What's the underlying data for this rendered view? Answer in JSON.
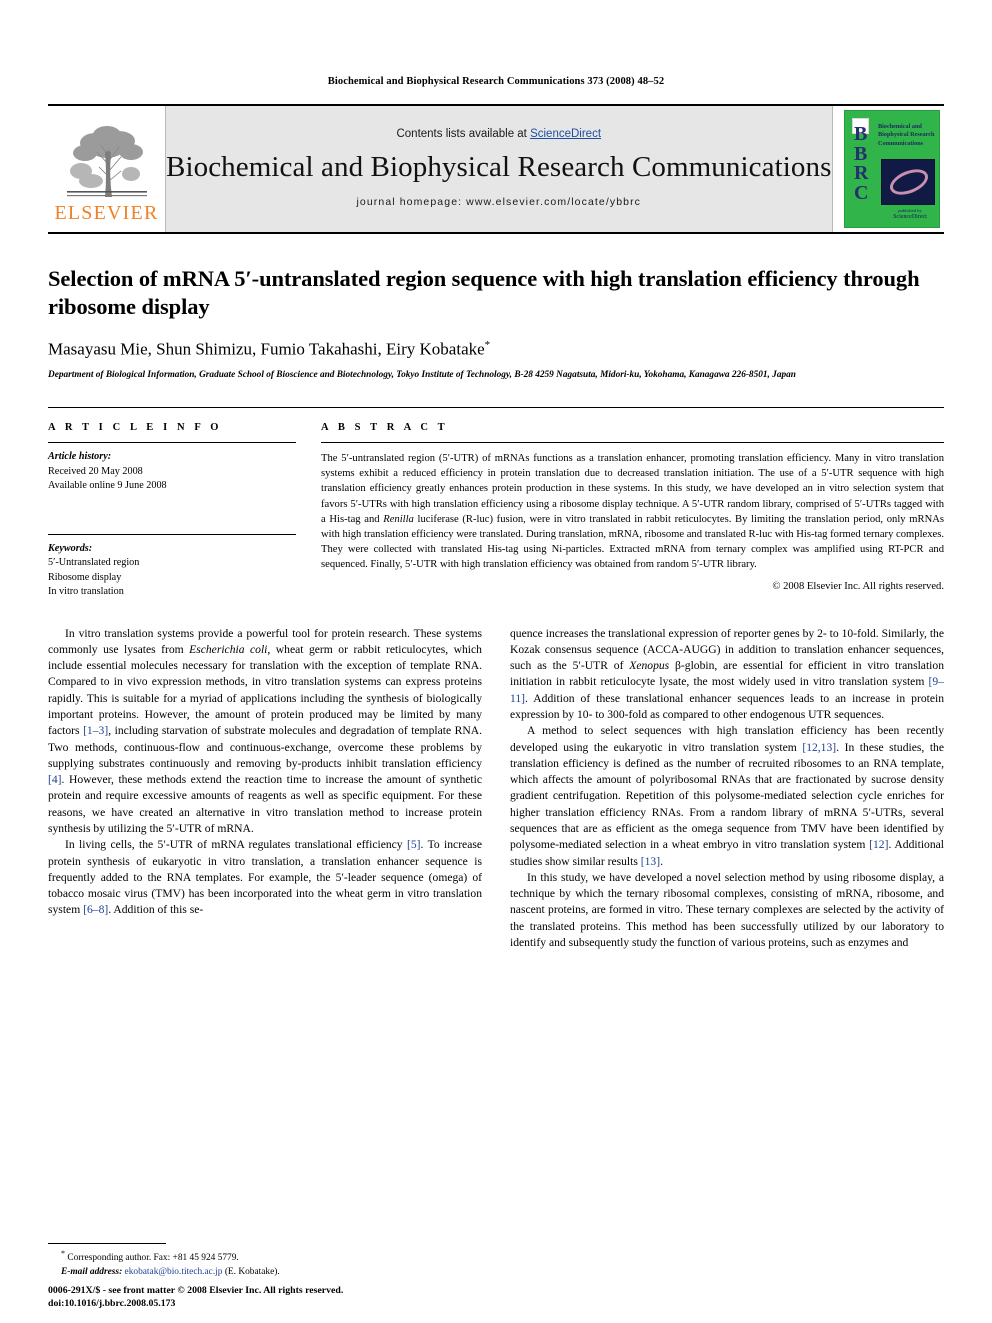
{
  "running_head": "Biochemical and Biophysical Research Communications 373 (2008) 48–52",
  "masthead": {
    "publisher_name": "ELSEVIER",
    "contents_prefix": "Contents lists available at ",
    "sciencedirect": "ScienceDirect",
    "journal_title": "Biochemical and Biophysical Research Communications",
    "homepage": "journal homepage: www.elsevier.com/locate/ybbrc",
    "cover": {
      "acronym": "BBRC",
      "title_lines": "Biochemical and Biophysical Research Communications",
      "imprint_small": "published by",
      "imprint_big": "ScienceDirect"
    }
  },
  "article": {
    "title": "Selection of mRNA 5′-untranslated region sequence with high translation efficiency through ribosome display",
    "authors": "Masayasu Mie, Shun Shimizu, Fumio Takahashi, Eiry Kobatake",
    "corresponding_marker": "*",
    "affiliation": "Department of Biological Information, Graduate School of Bioscience and Biotechnology, Tokyo Institute of Technology, B-28 4259 Nagatsuta, Midori-ku, Yokohama, Kanagawa 226-8501, Japan"
  },
  "article_info": {
    "heading": "A R T I C L E  I N F O",
    "history_label": "Article history:",
    "received": "Received 20 May 2008",
    "available_online": "Available online 9 June 2008",
    "keywords_label": "Keywords:",
    "keywords": [
      "5′-Untranslated region",
      "Ribosome display",
      "In vitro translation"
    ]
  },
  "abstract": {
    "heading": "A B S T R A C T",
    "part1": "The 5′-untranslated region (5′-UTR) of mRNAs functions as a translation enhancer, promoting translation efficiency. Many in vitro translation systems exhibit a reduced efficiency in protein translation due to decreased translation initiation. The use of a 5′-UTR sequence with high translation efficiency greatly enhances protein production in these systems. In this study, we have developed an in vitro selection system that favors 5′-UTRs with high translation efficiency using a ribosome display technique. A 5′-UTR random library, comprised of 5′-UTRs tagged with a His-tag and ",
    "italic1": "Renilla",
    "part2": " luciferase (R-luc) fusion, were in vitro translated in rabbit reticulocytes. By limiting the translation period, only mRNAs with high translation efficiency were translated. During translation, mRNA, ribosome and translated R-luc with His-tag formed ternary complexes. They were collected with translated His-tag using Ni-particles. Extracted mRNA from ternary complex was amplified using RT-PCR and sequenced. Finally, 5′-UTR with high translation efficiency was obtained from random 5′-UTR library.",
    "copyright": "© 2008 Elsevier Inc. All rights reserved."
  },
  "body": {
    "left": [
      {
        "indent": true,
        "segments": [
          {
            "t": "In vitro translation systems provide a powerful tool for protein research. These systems commonly use lysates from "
          },
          {
            "t": "Escherichia coli",
            "style": "italic"
          },
          {
            "t": ", wheat germ or rabbit reticulocytes, which include essential molecules necessary for translation with the exception of template RNA. Compared to in vivo expression methods, in vitro translation systems can express proteins rapidly. This is suitable for a myriad of applications including the synthesis of biologically important proteins. However, the amount of protein produced may be limited by many factors "
          },
          {
            "t": "[1–3]",
            "style": "ref"
          },
          {
            "t": ", including starvation of substrate molecules and degradation of template RNA. Two methods, continuous-flow and continuous-exchange, overcome these problems by supplying substrates continuously and removing by-products inhibit translation efficiency "
          },
          {
            "t": "[4]",
            "style": "ref"
          },
          {
            "t": ". However, these methods extend the reaction time to increase the amount of synthetic protein and require excessive amounts of reagents as well as specific equipment. For these reasons, we have created an alternative in vitro translation method to increase protein synthesis by utilizing the 5′-UTR of mRNA."
          }
        ]
      },
      {
        "indent": true,
        "segments": [
          {
            "t": "In living cells, the 5′-UTR of mRNA regulates translational efficiency "
          },
          {
            "t": "[5]",
            "style": "ref"
          },
          {
            "t": ". To increase protein synthesis of eukaryotic in vitro translation, a translation enhancer sequence is frequently added to the RNA templates. For example, the 5′-leader sequence (omega) of tobacco mosaic virus (TMV) has been incorporated into the wheat germ in vitro translation system "
          },
          {
            "t": "[6–8]",
            "style": "ref"
          },
          {
            "t": ". Addition of this se-"
          }
        ]
      }
    ],
    "right": [
      {
        "indent": false,
        "segments": [
          {
            "t": "quence increases the translational expression of reporter genes by 2- to 10-fold. Similarly, the Kozak consensus sequence (ACCA-AUGG) in addition to translation enhancer sequences, such as the 5′-UTR of "
          },
          {
            "t": "Xenopus",
            "style": "italic"
          },
          {
            "t": " β-globin, are essential for efficient in vitro translation initiation in rabbit reticulocyte lysate, the most widely used in vitro translation system "
          },
          {
            "t": "[9–11]",
            "style": "ref"
          },
          {
            "t": ". Addition of these translational enhancer sequences leads to an increase in protein expression by 10- to 300-fold as compared to other endogenous UTR sequences."
          }
        ]
      },
      {
        "indent": true,
        "segments": [
          {
            "t": "A method to select sequences with high translation efficiency has been recently developed using the eukaryotic in vitro translation system "
          },
          {
            "t": "[12,13]",
            "style": "ref"
          },
          {
            "t": ". In these studies, the translation efficiency is defined as the number of recruited ribosomes to an RNA template, which affects the amount of polyribosomal RNAs that are fractionated by sucrose density gradient centrifugation. Repetition of this polysome-mediated selection cycle enriches for higher translation efficiency RNAs. From a random library of mRNA 5′-UTRs, several sequences that are as efficient as the omega sequence from TMV have been identified by polysome-mediated selection in a wheat embryo in vitro translation system "
          },
          {
            "t": "[12]",
            "style": "ref"
          },
          {
            "t": ". Additional studies show similar results "
          },
          {
            "t": "[13]",
            "style": "ref"
          },
          {
            "t": "."
          }
        ]
      },
      {
        "indent": true,
        "segments": [
          {
            "t": "In this study, we have developed a novel selection method by using ribosome display, a technique by which the ternary ribosomal complexes, consisting of mRNA, ribosome, and nascent proteins, are formed in vitro. These ternary complexes are selected by the activity of the translated proteins. This method has been successfully utilized by our laboratory to identify and subsequently study the function of various proteins, such as enzymes and"
          }
        ]
      }
    ]
  },
  "footnotes": {
    "corresponding": "Corresponding author. Fax: +81 45 924 5779.",
    "email_label": "E-mail address:",
    "email": "ekobatak@bio.titech.ac.jp",
    "email_suffix": "(E. Kobatake)."
  },
  "footer": {
    "issn_line": "0006-291X/$ - see front matter © 2008 Elsevier Inc. All rights reserved.",
    "doi_line": "doi:10.1016/j.bbrc.2008.05.173"
  },
  "colors": {
    "elsevier_orange": "#f08127",
    "sciencedirect_blue": "#1f4ea1",
    "reference_blue": "#1f3f93",
    "cover_green": "#31b44a",
    "cover_blue": "#26306e",
    "masthead_gray": "#e6e6e6"
  }
}
